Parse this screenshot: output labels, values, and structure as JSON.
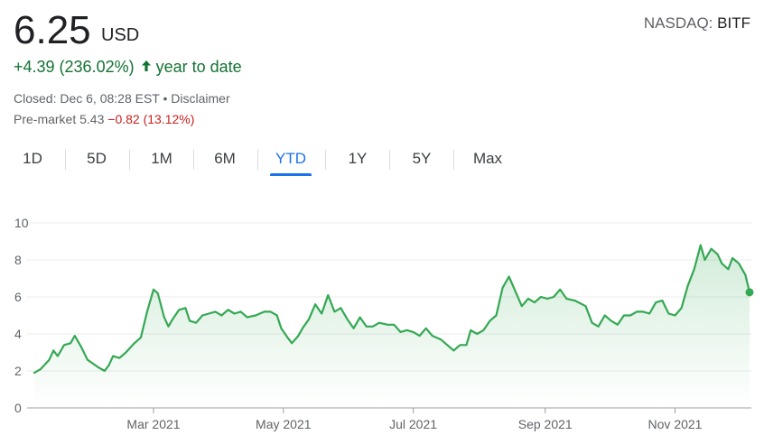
{
  "header": {
    "price": "6.25",
    "currency": "USD",
    "exchange": "NASDAQ:",
    "ticker": "BITF",
    "change": "+4.39 (236.02%)",
    "change_period": "year to date",
    "closed_line": "Closed: Dec 6, 08:28 EST • Disclaimer",
    "premarket_label": "Pre-market 5.43",
    "premarket_change": "−0.82 (13.12%)"
  },
  "tabs": [
    {
      "label": "1D",
      "active": false
    },
    {
      "label": "5D",
      "active": false
    },
    {
      "label": "1M",
      "active": false
    },
    {
      "label": "6M",
      "active": false
    },
    {
      "label": "YTD",
      "active": true
    },
    {
      "label": "1Y",
      "active": false
    },
    {
      "label": "5Y",
      "active": false
    },
    {
      "label": "Max",
      "active": false
    }
  ],
  "colors": {
    "up": "#137333",
    "line": "#34a853",
    "down": "#c5221f",
    "accent": "#1a73e8"
  },
  "chart_data": {
    "type": "area",
    "ylim": [
      0,
      10
    ],
    "yticks": [
      0,
      2,
      4,
      6,
      8,
      10
    ],
    "xtick_labels": [
      "Mar 2021",
      "May 2021",
      "Jul 2021",
      "Sep 2021",
      "Nov 2021"
    ],
    "xlim": [
      "2021-01-04",
      "2021-12-06"
    ],
    "xtick_dates": [
      "2021-03-01",
      "2021-05-01",
      "2021-07-01",
      "2021-09-01",
      "2021-11-01"
    ],
    "series": [
      {
        "points": [
          [
            "2021-01-04",
            1.9
          ],
          [
            "2021-01-07",
            2.1
          ],
          [
            "2021-01-11",
            2.6
          ],
          [
            "2021-01-13",
            3.1
          ],
          [
            "2021-01-15",
            2.8
          ],
          [
            "2021-01-18",
            3.4
          ],
          [
            "2021-01-21",
            3.5
          ],
          [
            "2021-01-23",
            3.9
          ],
          [
            "2021-01-26",
            3.3
          ],
          [
            "2021-01-29",
            2.6
          ],
          [
            "2021-02-03",
            2.2
          ],
          [
            "2021-02-06",
            2.0
          ],
          [
            "2021-02-08",
            2.3
          ],
          [
            "2021-02-10",
            2.8
          ],
          [
            "2021-02-13",
            2.7
          ],
          [
            "2021-02-16",
            3.0
          ],
          [
            "2021-02-20",
            3.5
          ],
          [
            "2021-02-23",
            3.8
          ],
          [
            "2021-02-26",
            5.2
          ],
          [
            "2021-03-01",
            6.4
          ],
          [
            "2021-03-03",
            6.2
          ],
          [
            "2021-03-06",
            4.9
          ],
          [
            "2021-03-08",
            4.4
          ],
          [
            "2021-03-10",
            4.8
          ],
          [
            "2021-03-13",
            5.3
          ],
          [
            "2021-03-16",
            5.4
          ],
          [
            "2021-03-18",
            4.7
          ],
          [
            "2021-03-21",
            4.6
          ],
          [
            "2021-03-24",
            5.0
          ],
          [
            "2021-03-27",
            5.1
          ],
          [
            "2021-03-30",
            5.2
          ],
          [
            "2021-04-02",
            5.0
          ],
          [
            "2021-04-05",
            5.3
          ],
          [
            "2021-04-08",
            5.1
          ],
          [
            "2021-04-11",
            5.2
          ],
          [
            "2021-04-14",
            4.9
          ],
          [
            "2021-04-18",
            5.0
          ],
          [
            "2021-04-22",
            5.2
          ],
          [
            "2021-04-25",
            5.2
          ],
          [
            "2021-04-28",
            5.0
          ],
          [
            "2021-04-30",
            4.3
          ],
          [
            "2021-05-03",
            3.8
          ],
          [
            "2021-05-05",
            3.5
          ],
          [
            "2021-05-08",
            3.9
          ],
          [
            "2021-05-10",
            4.3
          ],
          [
            "2021-05-13",
            4.8
          ],
          [
            "2021-05-16",
            5.6
          ],
          [
            "2021-05-19",
            5.1
          ],
          [
            "2021-05-22",
            6.1
          ],
          [
            "2021-05-25",
            5.2
          ],
          [
            "2021-05-28",
            5.4
          ],
          [
            "2021-05-31",
            4.8
          ],
          [
            "2021-06-03",
            4.3
          ],
          [
            "2021-06-06",
            4.9
          ],
          [
            "2021-06-09",
            4.4
          ],
          [
            "2021-06-12",
            4.4
          ],
          [
            "2021-06-15",
            4.6
          ],
          [
            "2021-06-19",
            4.5
          ],
          [
            "2021-06-22",
            4.5
          ],
          [
            "2021-06-25",
            4.1
          ],
          [
            "2021-06-28",
            4.2
          ],
          [
            "2021-07-01",
            4.1
          ],
          [
            "2021-07-04",
            3.9
          ],
          [
            "2021-07-07",
            4.3
          ],
          [
            "2021-07-10",
            3.9
          ],
          [
            "2021-07-14",
            3.7
          ],
          [
            "2021-07-17",
            3.4
          ],
          [
            "2021-07-20",
            3.1
          ],
          [
            "2021-07-23",
            3.4
          ],
          [
            "2021-07-26",
            3.4
          ],
          [
            "2021-07-28",
            4.2
          ],
          [
            "2021-07-31",
            4.0
          ],
          [
            "2021-08-03",
            4.2
          ],
          [
            "2021-08-06",
            4.7
          ],
          [
            "2021-08-09",
            5.0
          ],
          [
            "2021-08-12",
            6.5
          ],
          [
            "2021-08-15",
            7.1
          ],
          [
            "2021-08-18",
            6.3
          ],
          [
            "2021-08-21",
            5.5
          ],
          [
            "2021-08-24",
            5.9
          ],
          [
            "2021-08-27",
            5.7
          ],
          [
            "2021-08-30",
            6.0
          ],
          [
            "2021-09-02",
            5.9
          ],
          [
            "2021-09-05",
            6.0
          ],
          [
            "2021-09-08",
            6.4
          ],
          [
            "2021-09-11",
            5.9
          ],
          [
            "2021-09-15",
            5.8
          ],
          [
            "2021-09-20",
            5.5
          ],
          [
            "2021-09-23",
            4.6
          ],
          [
            "2021-09-26",
            4.4
          ],
          [
            "2021-09-29",
            5.0
          ],
          [
            "2021-10-02",
            4.7
          ],
          [
            "2021-10-05",
            4.5
          ],
          [
            "2021-10-08",
            5.0
          ],
          [
            "2021-10-11",
            5.0
          ],
          [
            "2021-10-14",
            5.2
          ],
          [
            "2021-10-17",
            5.2
          ],
          [
            "2021-10-20",
            5.1
          ],
          [
            "2021-10-23",
            5.7
          ],
          [
            "2021-10-26",
            5.8
          ],
          [
            "2021-10-29",
            5.1
          ],
          [
            "2021-11-01",
            5.0
          ],
          [
            "2021-11-04",
            5.4
          ],
          [
            "2021-11-07",
            6.6
          ],
          [
            "2021-11-10",
            7.5
          ],
          [
            "2021-11-13",
            8.8
          ],
          [
            "2021-11-15",
            8.0
          ],
          [
            "2021-11-18",
            8.6
          ],
          [
            "2021-11-21",
            8.3
          ],
          [
            "2021-11-23",
            7.8
          ],
          [
            "2021-11-26",
            7.5
          ],
          [
            "2021-11-28",
            8.1
          ],
          [
            "2021-12-01",
            7.8
          ],
          [
            "2021-12-04",
            7.2
          ],
          [
            "2021-12-06",
            6.25
          ]
        ]
      }
    ]
  }
}
